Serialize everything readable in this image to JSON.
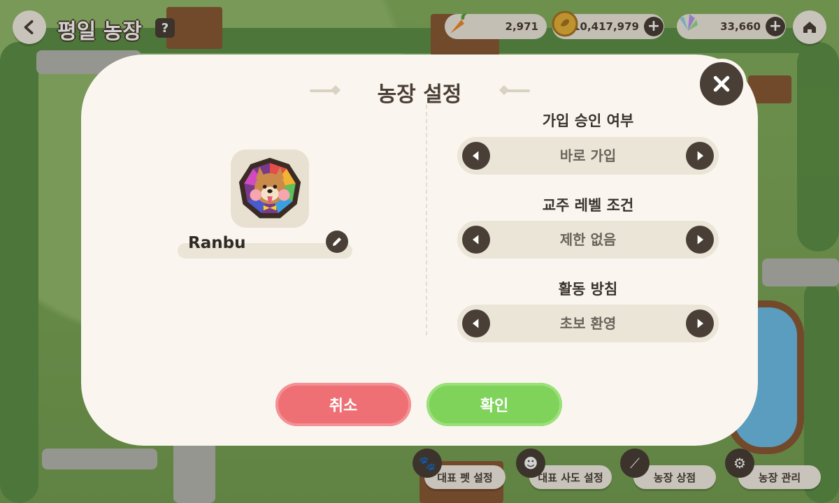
{
  "header": {
    "title": "평일 농장",
    "help_label": "?",
    "resources": [
      {
        "icon": "carrot-icon",
        "value": "2,971"
      },
      {
        "icon": "gold-coin-icon",
        "value": "10,417,979"
      },
      {
        "icon": "crystal-icon",
        "value": "33,660"
      }
    ],
    "plus_label": "+"
  },
  "bottom_menu": [
    {
      "label": "대표 펫 설정",
      "icon": "paw-icon"
    },
    {
      "label": "대표 사도 설정",
      "icon": "character-icon"
    },
    {
      "label": "농장 상점",
      "icon": "vegetable-icon"
    },
    {
      "label": "농장 관리",
      "icon": "gear-icon"
    }
  ],
  "modal": {
    "title": "농장 설정",
    "farm_name": "Ranbu",
    "options": [
      {
        "label": "가입 승인 여부",
        "value": "바로 가입"
      },
      {
        "label": "교주 레벨 조건",
        "value": "제한 없음"
      },
      {
        "label": "활동 방침",
        "value": "초보 환영"
      }
    ],
    "cancel_label": "취소",
    "confirm_label": "확인"
  },
  "colors": {
    "panel": "#faf6ef",
    "dark": "#4a3f36",
    "cancel": "#ee6f74",
    "confirm": "#7fd35a"
  }
}
